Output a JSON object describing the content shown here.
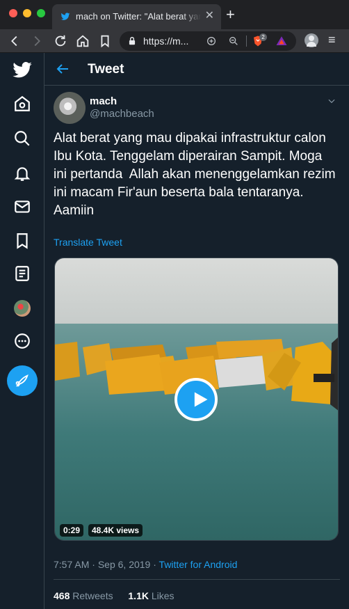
{
  "browser": {
    "tab_title": "mach on Twitter: \"Alat berat yang mau dipakai infrastruktur calon Ibu Kota",
    "tab_close": "✕",
    "new_tab": "+",
    "url": "https://m...",
    "brave_badge": "2",
    "menu": "≡"
  },
  "nav": {
    "compose_label": "Tweet"
  },
  "header": {
    "title": "Tweet"
  },
  "tweet": {
    "display_name": "mach",
    "handle": "@machbeach",
    "text": "Alat berat yang mau dipakai infrastruktur calon Ibu Kota. Tenggelam diperairan Sampit. Moga ini pertanda  Allah akan menenggelamkan rezim ini macam Fir'aun beserta bala tentaranya. Aamiin",
    "translate_label": "Translate Tweet",
    "video": {
      "duration": "0:29",
      "views": "48.4K views"
    },
    "time": "7:57 AM",
    "separator": "·",
    "date": "Sep 6, 2019",
    "source": "Twitter for Android",
    "retweets_count": "468",
    "retweets_label": "Retweets",
    "likes_count": "1.1K",
    "likes_label": "Likes"
  },
  "colors": {
    "background": "#15202b",
    "accent": "#1da1f2",
    "muted": "#8899a6",
    "border": "#38444d"
  }
}
